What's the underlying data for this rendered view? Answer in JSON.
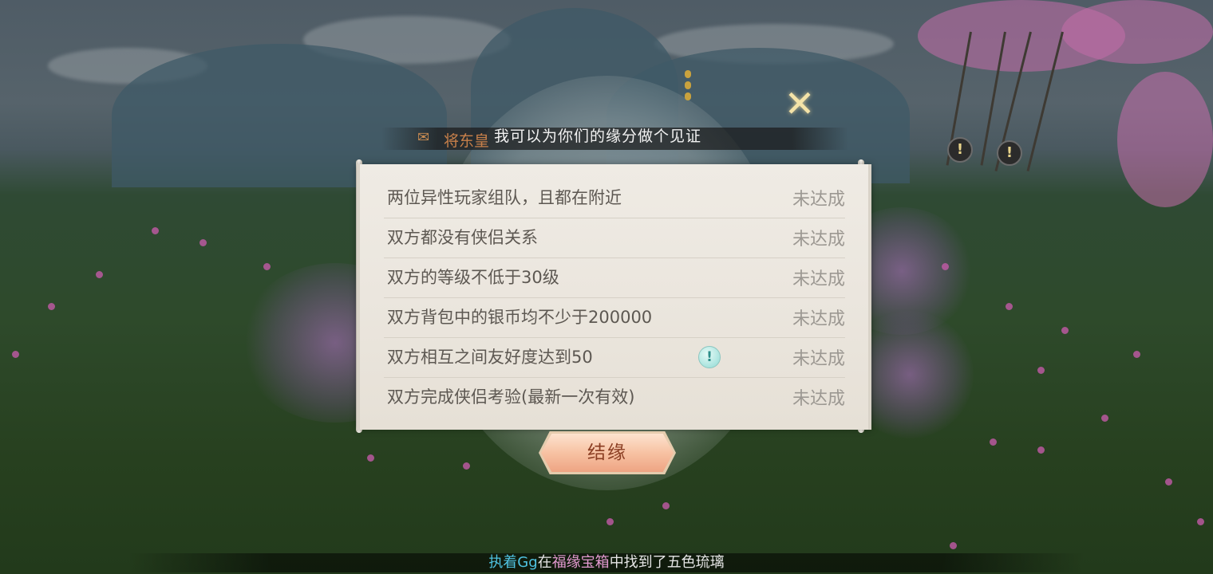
{
  "npc": {
    "name": "将东皇",
    "dialogue": "我可以为你们的缘分做个见证"
  },
  "close_icon": "close-x-icon",
  "conditions": [
    {
      "text": "两位异性玩家组队，且都在附近",
      "status": "未达成"
    },
    {
      "text": "双方都没有侠侣关系",
      "status": "未达成"
    },
    {
      "text": "双方的等级不低于30级",
      "status": "未达成"
    },
    {
      "text": "双方背包中的银币均不少于200000",
      "status": "未达成"
    },
    {
      "text": "双方相互之间友好度达到50",
      "status": "未达成",
      "info_icon": "!"
    },
    {
      "text": "双方完成侠侣考验(最新一次有效)",
      "status": "未达成"
    }
  ],
  "bond_button": {
    "label": "结缘"
  },
  "broadcast": {
    "player": "执着Gg",
    "text1": "在",
    "location": "福缘宝箱",
    "text2": "中找到了",
    "item": "五色琉璃"
  },
  "colors": {
    "status_gray": "#9c9892",
    "npc_name": "#c8804a",
    "button_text": "#8a3d22"
  }
}
